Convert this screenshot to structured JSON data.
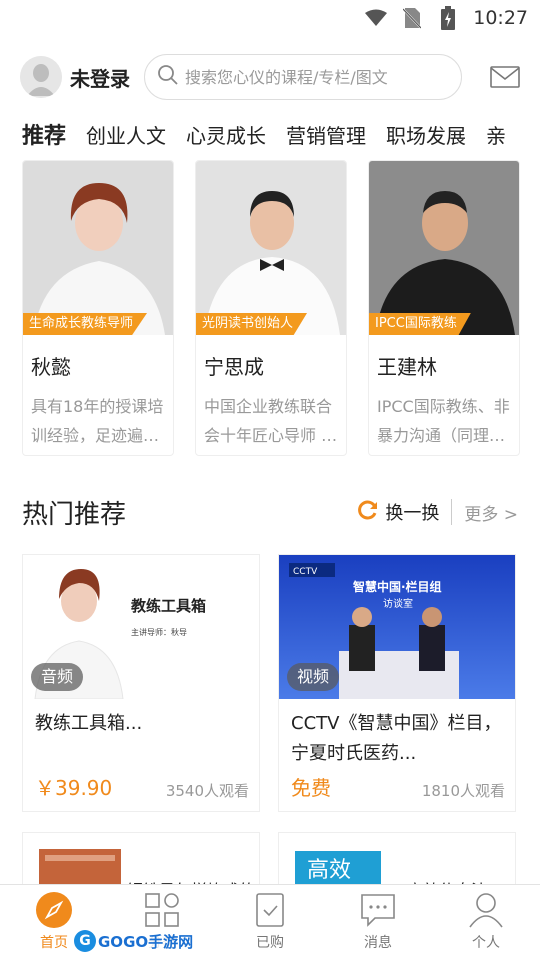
{
  "status_bar": {
    "time": "10:27",
    "icons": [
      "wifi-icon",
      "no-sim-icon",
      "battery-charging-icon"
    ]
  },
  "header": {
    "login_label": "未登录",
    "search_placeholder": "搜索您心仪的课程/专栏/图文"
  },
  "tabs": [
    {
      "label": "推荐",
      "active": true
    },
    {
      "label": "创业人文"
    },
    {
      "label": "心灵成长"
    },
    {
      "label": "营销管理"
    },
    {
      "label": "职场发展"
    },
    {
      "label": "亲"
    }
  ],
  "teachers": [
    {
      "tag": "生命成长教练导师",
      "name": "秋懿",
      "desc": "具有18年的授课培训经验，足迹遍…"
    },
    {
      "tag": "光阴读书创始人",
      "name": "宁思成",
      "desc": "中国企业教练联合会十年匠心导师 …"
    },
    {
      "tag": "IPCC国际教练",
      "name": "王建林",
      "desc": "IPCC国际教练、非暴力沟通（同理…"
    }
  ],
  "hot": {
    "title": "热门推荐",
    "refresh_label": "换一换",
    "more_label": "更多 >"
  },
  "courses": [
    {
      "badge": "音频",
      "title": "教练工具箱...",
      "price": "￥39.90",
      "views": "3540人观看",
      "thumb_title": "教练工具箱",
      "thumb_sub": "主讲导师：秋导"
    },
    {
      "badge": "视频",
      "title": "CCTV《智慧中国》栏目，宁夏时氏医药...",
      "price": "免费",
      "views": "1810人观看",
      "thumb_title": "智慧中国·栏目组",
      "thumb_sub": "访谈室"
    }
  ],
  "courses_partial": [
    {
      "title": "铜铁是怎样炼成的"
    },
    {
      "title": "高效休息法"
    }
  ],
  "bottom_nav": [
    {
      "label": "首页",
      "icon": "compass-icon",
      "active": true
    },
    {
      "label": "分类",
      "icon": "grid-icon"
    },
    {
      "label": "已购",
      "icon": "purchased-icon"
    },
    {
      "label": "消息",
      "icon": "message-icon"
    },
    {
      "label": "个人",
      "icon": "person-icon"
    }
  ],
  "watermark": "GOGO手游网",
  "colors": {
    "accent": "#f08a1c",
    "tag": "#f39a1e"
  }
}
